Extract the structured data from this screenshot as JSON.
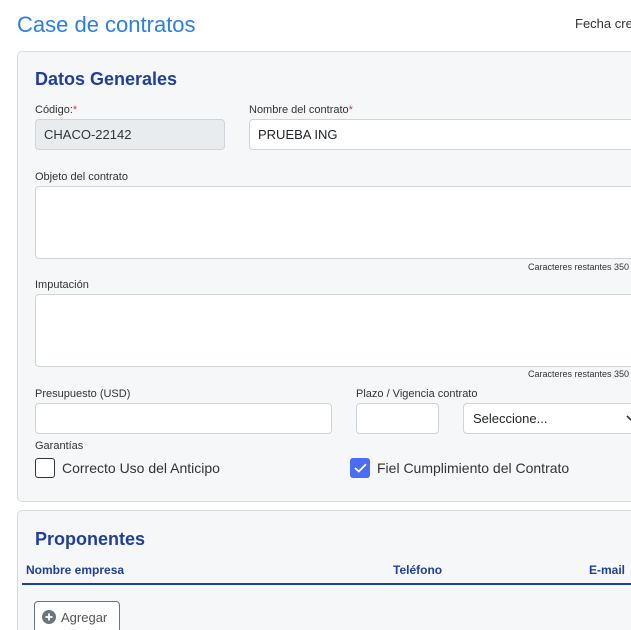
{
  "header": {
    "title": "Case de contratos",
    "meta_label": "Fecha cre"
  },
  "general": {
    "title": "Datos Generales",
    "codigo": {
      "label": "Código:",
      "required": "*",
      "value": "CHACO-22142"
    },
    "nombre": {
      "label": "Nombre del contrato",
      "required": "*",
      "value": "PRUEBA ING"
    },
    "objeto": {
      "label": "Objeto del contrato",
      "counter": "Caracteres restantes 350"
    },
    "imputacion": {
      "label": "Imputación",
      "counter": "Caracteres restantes 350"
    },
    "presupuesto": {
      "label": "Presupuesto (USD)",
      "value": ""
    },
    "plazo": {
      "label": "Plazo / Vigencia contrato",
      "value": "",
      "unit_selected": "Seleccione..."
    },
    "garantias": {
      "label": "Garantías",
      "items": [
        {
          "label": "Correcto Uso del Anticipo",
          "checked": false
        },
        {
          "label": "Fiel Cumplimiento del Contrato",
          "checked": true
        }
      ]
    }
  },
  "proponentes": {
    "title": "Proponentes",
    "columns": [
      "Nombre empresa",
      "Teléfono",
      "E-mail"
    ],
    "add_button": "Agregar"
  },
  "colors": {
    "title_blue": "#2b7de9",
    "section_blue": "#1f3f9e",
    "checkbox_checked": "#4a6cf7",
    "required_red": "#dc3545"
  }
}
